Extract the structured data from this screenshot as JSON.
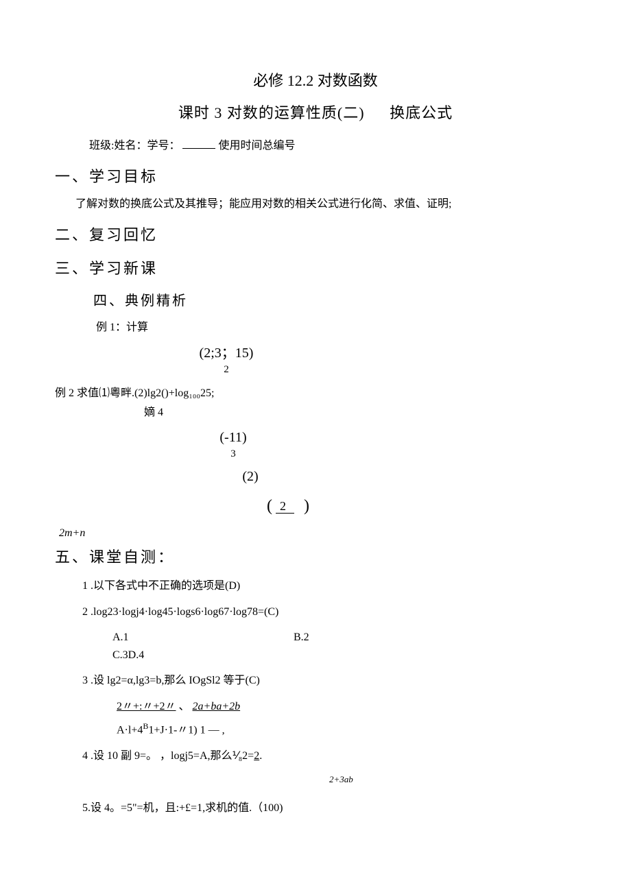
{
  "title_main": "必修 12.2 对数函数",
  "title_sub_a": "课时 3 对数的运算性质(二)",
  "title_sub_b": "换底公式",
  "info_prefix": "班级:姓名：学号：",
  "info_suffix": "使用时间总编号",
  "sections": {
    "s1": "一、学习目标",
    "s1_body": "了解对数的换底公式及其推导；能应用对数的相关公式进行化简、求值、证明;",
    "s2": "二、复习回忆",
    "s3": "三、学习新课",
    "s4": "四、典例精析",
    "s5": "五、课堂自测："
  },
  "ex1_label": "例 1：计算",
  "ex1_math_top": "(2;3；15)",
  "ex1_math_bot": "2",
  "ex2_line": "例 2 求值⑴粵畔.(2)lg2()+log₁₀₀25;",
  "ex2_sub": "嫡 4",
  "ex2_block1_top": "(-11)",
  "ex2_block1_bot": "3",
  "ex2_block2": "(2)",
  "ex2_frac_num": "2",
  "italic_line": "2m+n",
  "questions": {
    "q1": "1    .以下各式中不正确的选项是(D)",
    "q2": "2    .log23·logj4·log45·logs6·log67·log78=(C)",
    "q2_a": "A.1",
    "q2_b": "B.2",
    "q2_c": "C.3",
    "q2_d": "D.4",
    "q3": "3    .设 lg2=α,lg3=b,那么 IOgSl2 等于(C)",
    "q3_line_u": "2〃+:〃+2〃",
    "q3_line_u2": "2a+ba+2b",
    "q3_line2": "A·l+4",
    "q3_line2b": "B",
    "q3_line2c": "1+J·1-〃1) 1 —  ,",
    "q4": "4    .设 10 副 9=。  ，logj5=A,那么⅟₈2=",
    "q4_ans": "2",
    "q4_note": "2+3ab",
    "q5": "5.设 4。=5\"=机，且:+£=1,求机的值.（100)"
  }
}
